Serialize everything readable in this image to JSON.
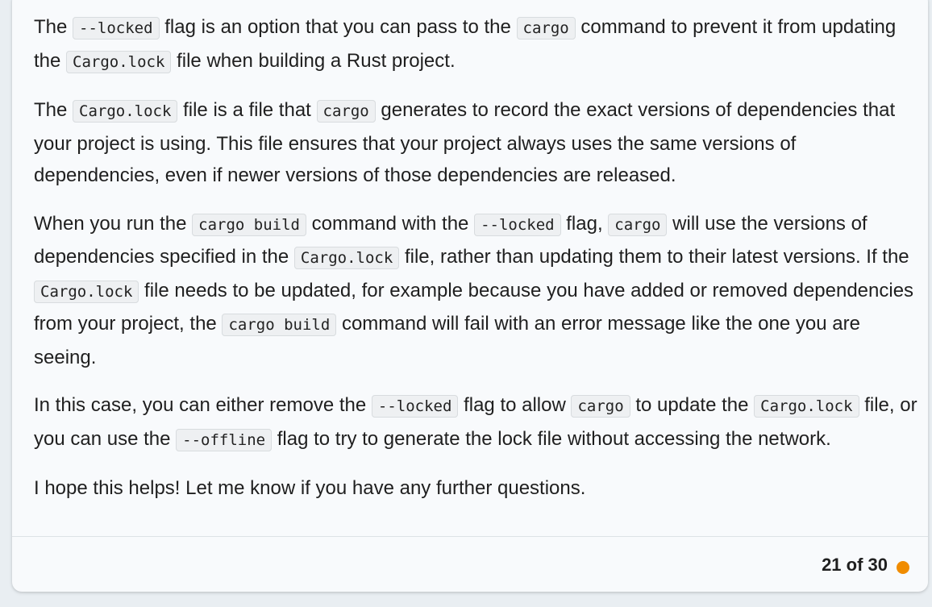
{
  "message": {
    "p1": {
      "t1": "The ",
      "c1": "--locked",
      "t2": " flag is an option that you can pass to the ",
      "c2": "cargo",
      "t3": " command to prevent it from updating the ",
      "c3": "Cargo.lock",
      "t4": " file when building a Rust project."
    },
    "p2": {
      "t1": "The ",
      "c1": "Cargo.lock",
      "t2": " file is a file that ",
      "c2": "cargo",
      "t3": " generates to record the exact versions of dependencies that your project is using. This file ensures that your project always uses the same versions of dependencies, even if newer versions of those dependencies are released."
    },
    "p3": {
      "t1": "When you run the ",
      "c1": "cargo build",
      "t2": " command with the ",
      "c2": "--locked",
      "t3": " flag, ",
      "c3": "cargo",
      "t4": " will use the versions of dependencies specified in the ",
      "c4": "Cargo.lock",
      "t5": " file, rather than updating them to their latest versions. If the ",
      "c5": "Cargo.lock",
      "t6": " file needs to be updated, for example because you have added or removed dependencies from your project, the ",
      "c6": "cargo build",
      "t7": " command will fail with an error message like the one you are seeing."
    },
    "p4": {
      "t1": "In this case, you can either remove the ",
      "c1": "--locked",
      "t2": " flag to allow ",
      "c2": "cargo",
      "t3": " to update the ",
      "c3": "Cargo.lock",
      "t4": " file, or you can use the ",
      "c4": "--offline",
      "t5": " flag to try to generate the lock file without accessing the network."
    },
    "p5": {
      "t1": "I hope this helps! Let me know if you have any further questions."
    }
  },
  "footer": {
    "page_indicator": "21 of 30",
    "status_color": "#f08c00"
  }
}
